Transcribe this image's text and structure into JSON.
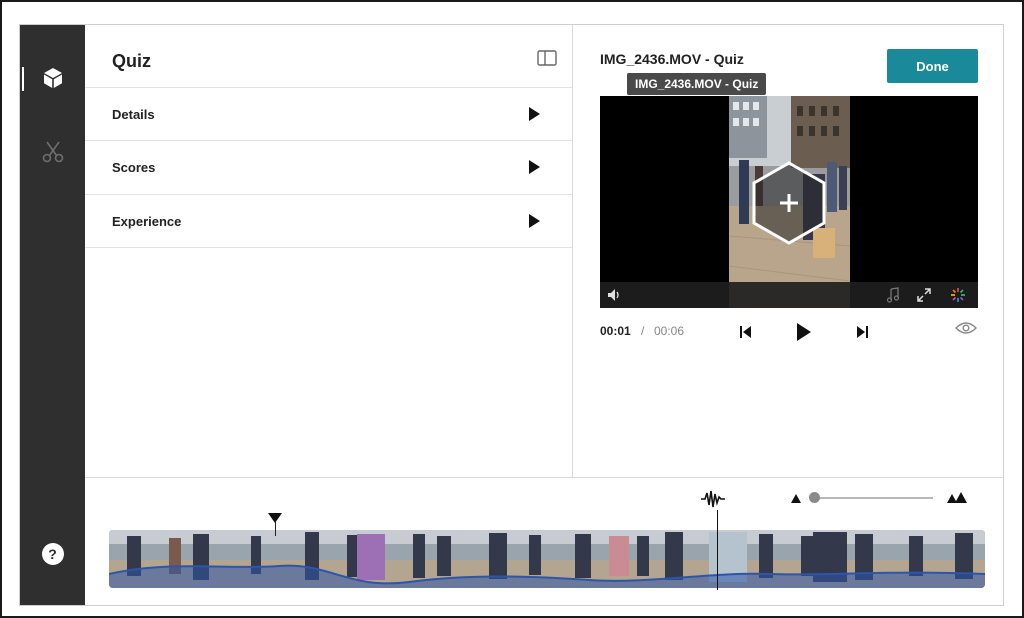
{
  "sidebar": {
    "items": [
      {
        "icon": "cube-icon",
        "active": true
      },
      {
        "icon": "scissors-icon",
        "active": false
      }
    ],
    "help_label": "?"
  },
  "panel": {
    "title": "Quiz",
    "items": [
      {
        "label": "Details"
      },
      {
        "label": "Scores"
      },
      {
        "label": "Experience"
      }
    ]
  },
  "media": {
    "title": "IMG_2436.MOV - Quiz",
    "tooltip": "IMG_2436.MOV - Quiz",
    "done_label": "Done",
    "current_time": "00:01",
    "separator": "/",
    "total_time": "00:06"
  },
  "colors": {
    "accent": "#1a8a9a",
    "sidebar": "#2f2f2f",
    "waveform": "#2e56a8"
  },
  "timeline": {
    "zoom_level": 0.05
  }
}
